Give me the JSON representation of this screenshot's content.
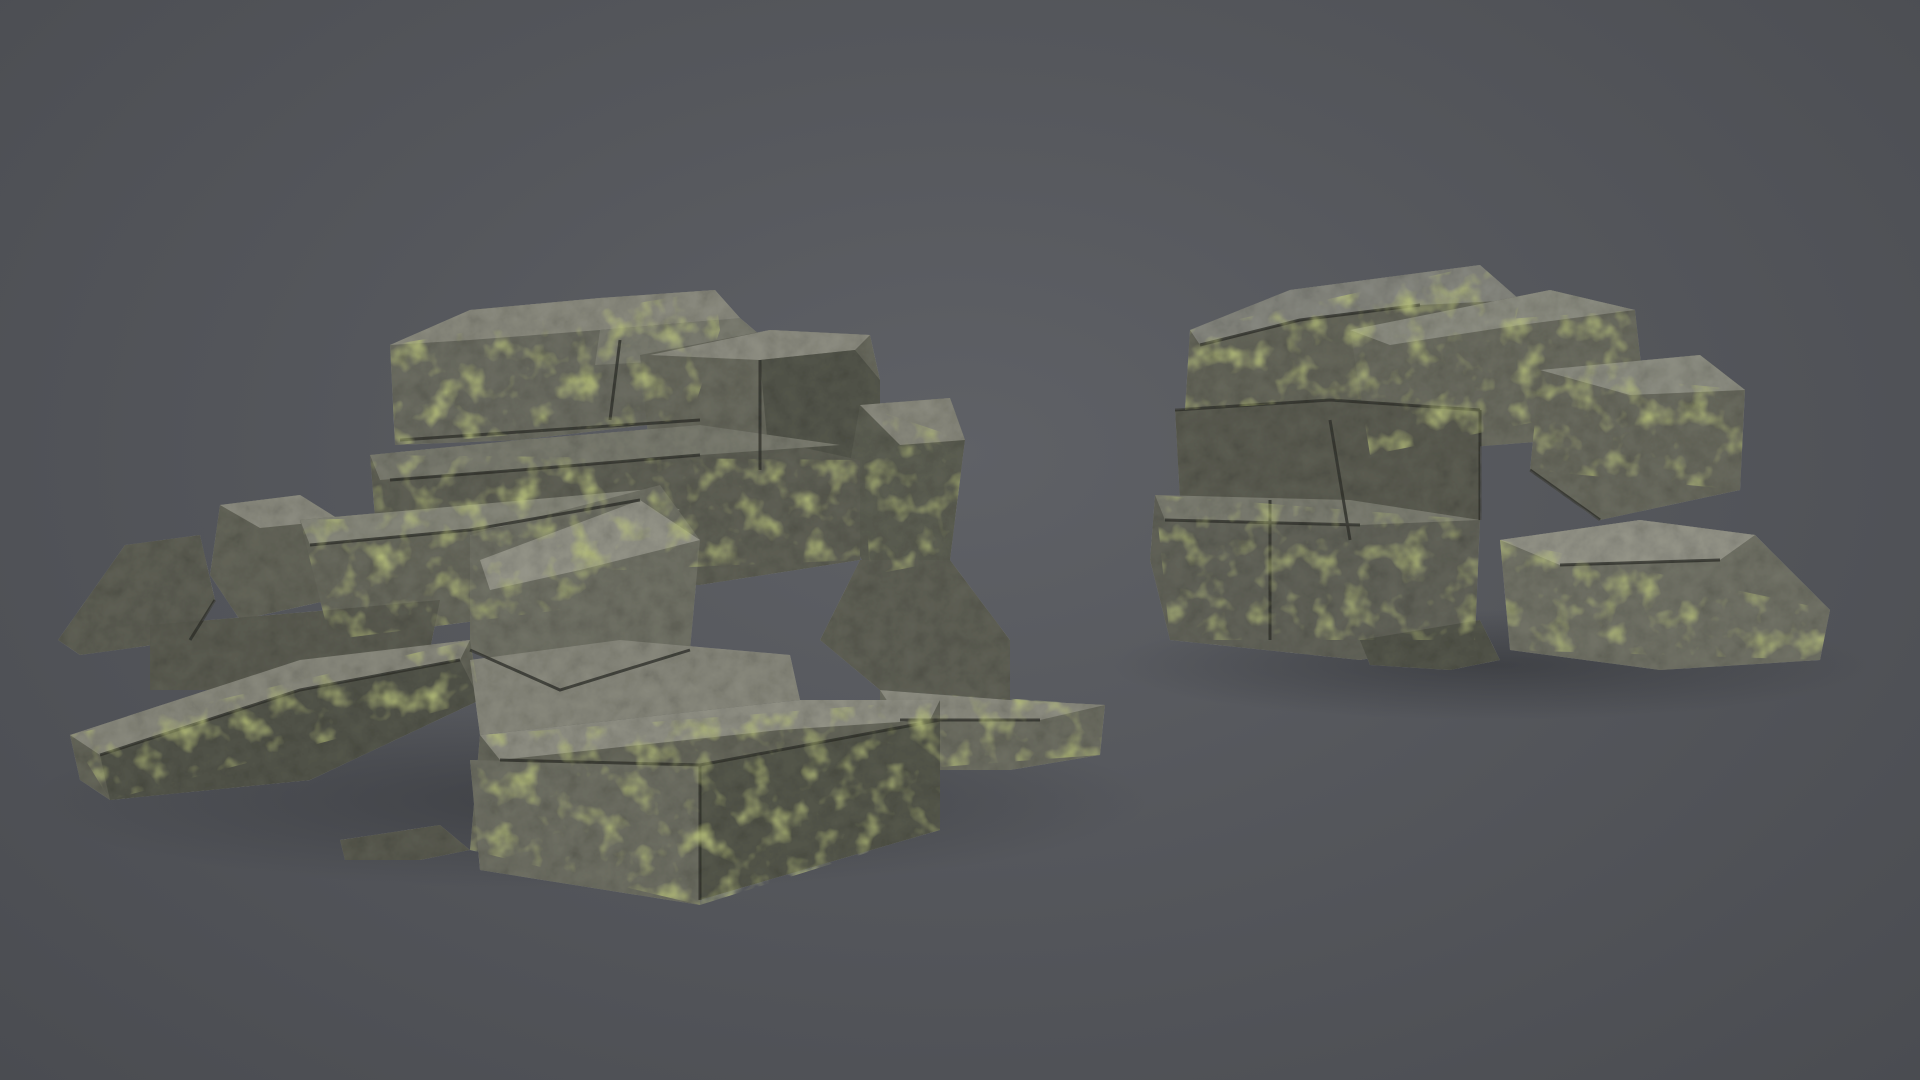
{
  "scene": {
    "background_color": "#55575c",
    "rock_base_color": "#6f6f63",
    "rock_shadow_color": "#3b3d36",
    "rock_highlight_color": "#9a9a8c",
    "moss_color": "#8a9a3a",
    "objects": [
      {
        "kind": "rock-pile",
        "description_name": "large-mossy-rock-cluster"
      },
      {
        "kind": "rock-pile",
        "description_name": "small-mossy-rock-cluster"
      }
    ]
  }
}
